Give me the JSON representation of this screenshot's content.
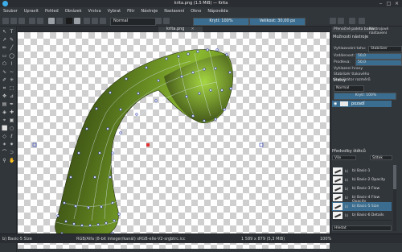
{
  "window": {
    "title": "krita.png (1.5 MiB) — Krita"
  },
  "menu": [
    "Soubor",
    "Upravit",
    "Pohled",
    "Obrázek",
    "Vrstva",
    "Vybrat",
    "Filtr",
    "Nástroje",
    "Nastavení",
    "Okno",
    "Nápověda"
  ],
  "toolbar": {
    "blend_mode": "Normal",
    "opacity": "Krytí: 100%",
    "size": "Velikost: 30,00 px"
  },
  "document_tab": {
    "label": "krita.png"
  },
  "tool_options": {
    "tabs": [
      "Přenočné paleta barev",
      "Nástrojové nastavení"
    ],
    "heading": "Možnosti nástroje",
    "fields": [
      {
        "label": "Vyhlazování tahu:",
        "value": "Stabilizer"
      },
      {
        "label": "Vzdálenost:",
        "value": "50,0"
      },
      {
        "label": "Prodleva:",
        "value": "50,0"
      },
      {
        "label": "Vyhlazení hrany",
        "value": ""
      },
      {
        "label": "Stabilizér tlakového",
        "value": ""
      },
      {
        "label": "Stabilizátor rozměrů",
        "value": ""
      }
    ]
  },
  "layers": {
    "title": "Vrstvy",
    "blend": "Normal",
    "opacity": "Krytí: 100%",
    "items": [
      {
        "name": "pozadí"
      }
    ]
  },
  "presets": {
    "title": "Předvolby štětců",
    "filter": "Vše",
    "tag": "Štítek",
    "items": [
      {
        "num": "b)",
        "name": "b) Basic-1"
      },
      {
        "num": "b)",
        "name": "b) Basic-2 Opacity"
      },
      {
        "num": "b)",
        "name": "b) Basic-3 Flow"
      },
      {
        "num": "b)",
        "name": "b) Basic-4 Flow Opacity"
      },
      {
        "num": "b)",
        "name": "b) Basic-5 Size"
      },
      {
        "num": "b)",
        "name": "b) Basic-6 Details"
      }
    ],
    "search": "Hledat"
  },
  "status": {
    "left": "b) Basic-5 Size",
    "center": "RGB/Alfa (8-bit integer/kanál) sRGB-elle-V2-srgbtrc.icc",
    "dims": "1 589 x 879 (5,3 MiB)",
    "zoom": "100%"
  },
  "colors": {
    "accent": "#3a6d8f",
    "bg": "#31363b",
    "shape_dark": "#2f3d12",
    "shape_light": "#9bcc3a"
  }
}
